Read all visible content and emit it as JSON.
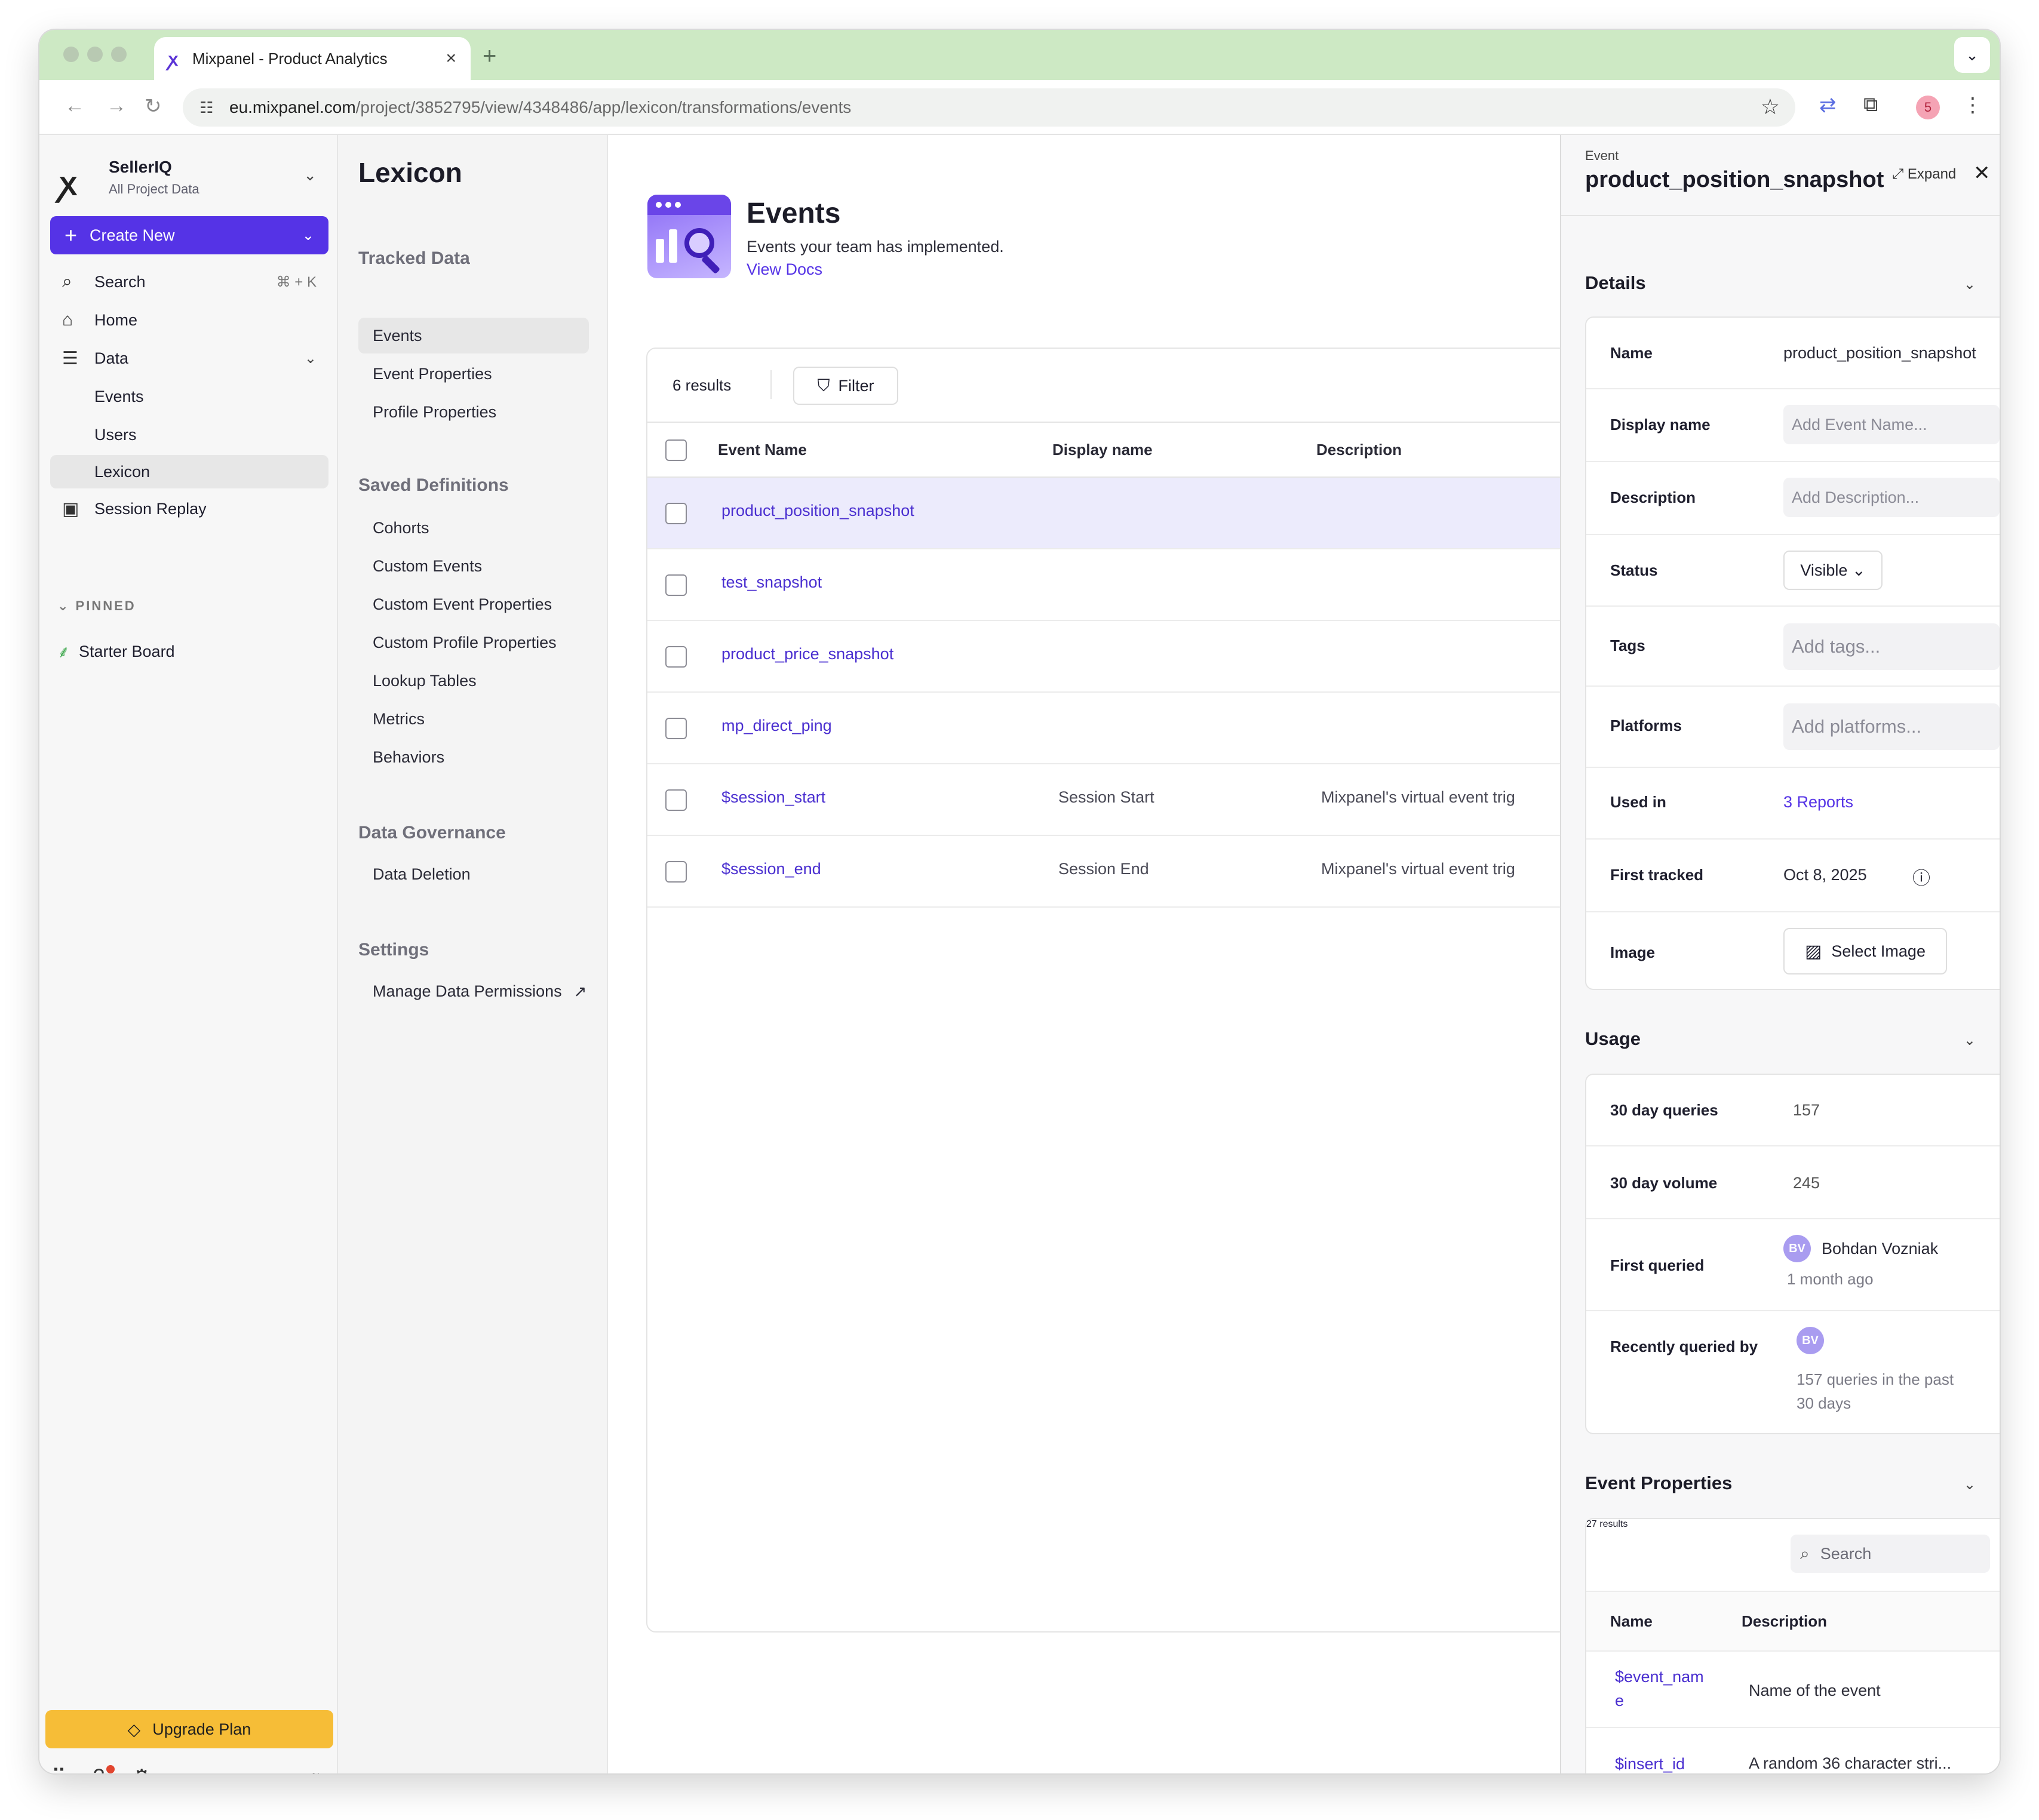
{
  "browser": {
    "tab_title": "Mixpanel - Product Analytics",
    "url_host": "eu.mixpanel.com",
    "url_path": "/project/3852795/view/4348486/app/lexicon/transformations/events",
    "profile_initial": "5"
  },
  "sidebar": {
    "org_name": "SellerIQ",
    "org_sub": "All Project Data",
    "create_label": "Create New",
    "search_label": "Search",
    "search_shortcut": "⌘ + K",
    "home_label": "Home",
    "data_label": "Data",
    "data_children": [
      "Events",
      "Users",
      "Lexicon"
    ],
    "session_replay_label": "Session Replay",
    "pinned_header": "PINNED",
    "starter_board": "Starter Board",
    "upgrade_label": "Upgrade Plan"
  },
  "secnav": {
    "title": "Lexicon",
    "tracked_header": "Tracked Data",
    "tracked_items": [
      "Events",
      "Event Properties",
      "Profile Properties"
    ],
    "saved_header": "Saved Definitions",
    "saved_items": [
      "Cohorts",
      "Custom Events",
      "Custom Event Properties",
      "Custom Profile Properties",
      "Lookup Tables",
      "Metrics",
      "Behaviors"
    ],
    "governance_header": "Data Governance",
    "governance_items": [
      "Data Deletion"
    ],
    "settings_header": "Settings",
    "settings_items": [
      "Manage Data Permissions"
    ]
  },
  "main": {
    "title": "Events",
    "subtitle": "Events your team has implemented.",
    "docs_link": "View Docs",
    "results": "6 results",
    "filter_label": "Filter",
    "columns": [
      "Event Name",
      "Display name",
      "Description"
    ],
    "rows": [
      {
        "name": "product_position_snapshot",
        "display": "",
        "desc": ""
      },
      {
        "name": "test_snapshot",
        "display": "",
        "desc": ""
      },
      {
        "name": "product_price_snapshot",
        "display": "",
        "desc": ""
      },
      {
        "name": "mp_direct_ping",
        "display": "",
        "desc": ""
      },
      {
        "name": "$session_start",
        "display": "Session Start",
        "desc": "Mixpanel's virtual event trig"
      },
      {
        "name": "$session_end",
        "display": "Session End",
        "desc": "Mixpanel's virtual event trig"
      }
    ]
  },
  "panel": {
    "kicker": "Event",
    "title": "product_position_snapshot",
    "expand_label": "Expand",
    "details_title": "Details",
    "details": {
      "name_label": "Name",
      "name_value": "product_position_snapshot",
      "display_label": "Display name",
      "display_placeholder": "Add Event Name...",
      "description_label": "Description",
      "description_placeholder": "Add Description...",
      "status_label": "Status",
      "status_value": "Visible",
      "tags_label": "Tags",
      "tags_placeholder": "Add tags...",
      "platforms_label": "Platforms",
      "platforms_placeholder": "Add platforms...",
      "used_in_label": "Used in",
      "used_in_value": "3 Reports",
      "first_tracked_label": "First tracked",
      "first_tracked_value": "Oct 8, 2025",
      "image_label": "Image",
      "image_button": "Select Image"
    },
    "usage_title": "Usage",
    "usage": {
      "queries_label": "30 day queries",
      "queries_value": "157",
      "volume_label": "30 day volume",
      "volume_value": "245",
      "first_queried_label": "First queried",
      "first_queried_initials": "BV",
      "first_queried_user": "Bohdan Vozniak",
      "first_queried_time": "1 month ago",
      "recent_label": "Recently queried by",
      "recent_initials": "BV",
      "recent_note_1": "157 queries in the past",
      "recent_note_2": "30 days"
    },
    "props_title": "Event Properties",
    "props": {
      "results": "27 results",
      "search_placeholder": "Search",
      "col_name": "Name",
      "col_desc": "Description",
      "rows": [
        {
          "name": "$event_name",
          "desc": "Name of the event"
        },
        {
          "name": "$insert_id",
          "desc": "A random 36 character stri..."
        }
      ]
    }
  }
}
